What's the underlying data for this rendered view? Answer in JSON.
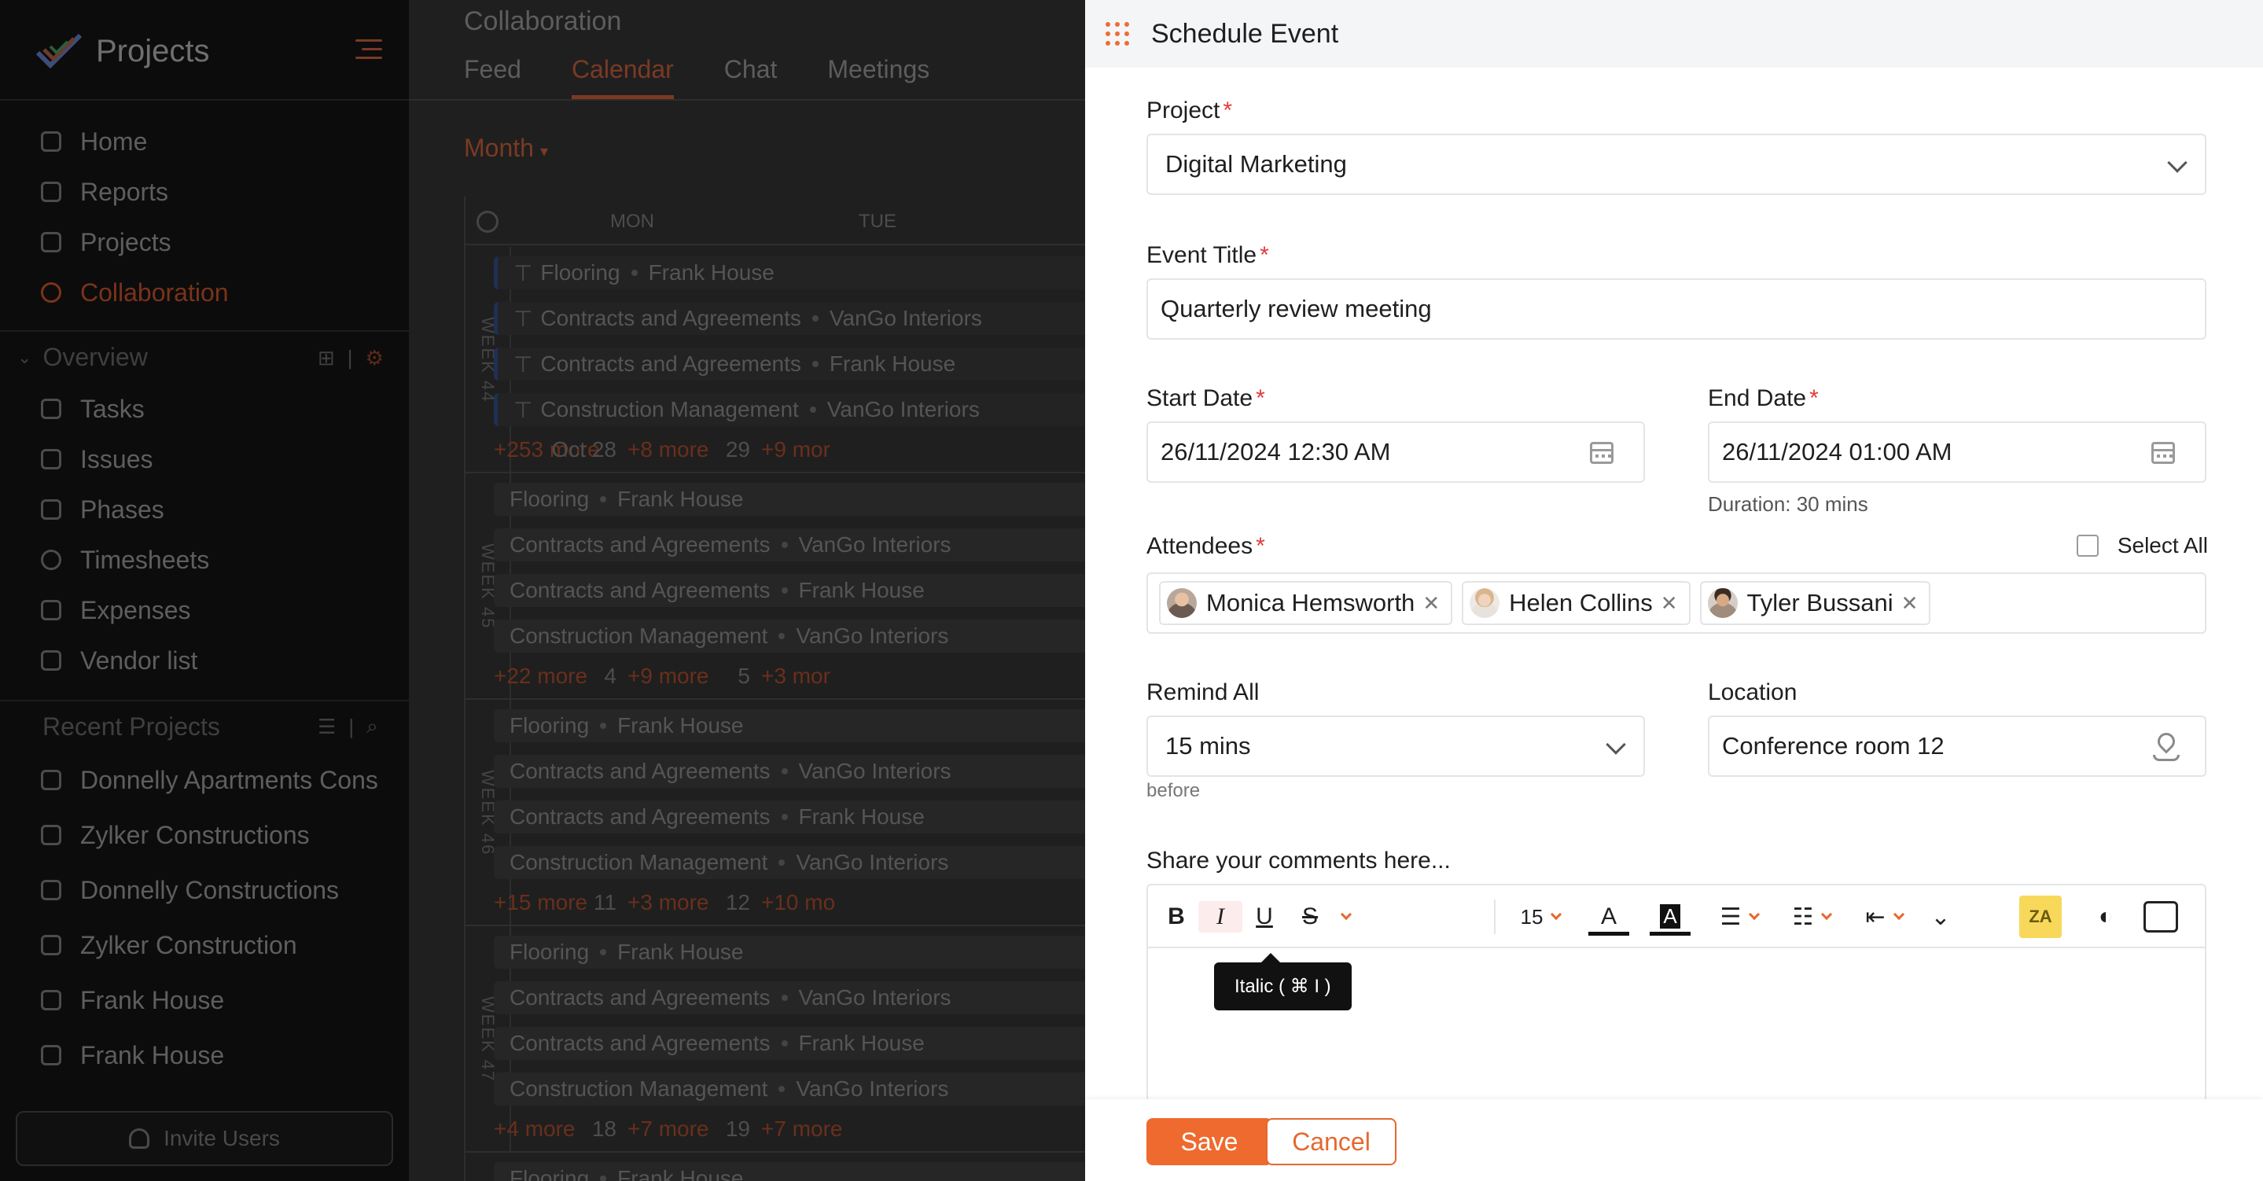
{
  "sidebar": {
    "app_name": "Projects",
    "nav": [
      {
        "label": "Home",
        "icon": "home-icon"
      },
      {
        "label": "Reports",
        "icon": "reports-icon"
      },
      {
        "label": "Projects",
        "icon": "projects-icon"
      },
      {
        "label": "Collaboration",
        "icon": "collaboration-icon",
        "active": true
      }
    ],
    "overview_title": "Overview",
    "overview_items": [
      {
        "label": "Tasks"
      },
      {
        "label": "Issues"
      },
      {
        "label": "Phases"
      },
      {
        "label": "Timesheets"
      },
      {
        "label": "Expenses"
      },
      {
        "label": "Vendor list"
      }
    ],
    "recent_title": "Recent Projects",
    "recent_items": [
      {
        "label": "Donnelly Apartments Cons"
      },
      {
        "label": "Zylker Constructions"
      },
      {
        "label": "Donnelly Constructions"
      },
      {
        "label": "Zylker Construction"
      },
      {
        "label": "Frank House"
      },
      {
        "label": "Frank House"
      }
    ],
    "invite_label": "Invite Users"
  },
  "calendar": {
    "title": "Collaboration",
    "tabs": [
      {
        "label": "Feed"
      },
      {
        "label": "Calendar",
        "active": true
      },
      {
        "label": "Chat"
      },
      {
        "label": "Meetings"
      }
    ],
    "view": "Month",
    "days": [
      "MON",
      "TUE"
    ],
    "weeks": [
      {
        "label": "WEEK 44",
        "events": [
          {
            "task": "Flooring",
            "project": "Frank House"
          },
          {
            "task": "Contracts and Agreements",
            "project": "VanGo Interiors"
          },
          {
            "task": "Contracts and Agreements",
            "project": "Frank House"
          },
          {
            "task": "Construction Management",
            "project": "VanGo Interiors"
          }
        ],
        "more": [
          "+253 more",
          "+8 more",
          "+9 mor"
        ],
        "dates": [
          "Oct 28",
          "29"
        ]
      },
      {
        "label": "WEEK 45",
        "events": [
          {
            "task": "Flooring",
            "project": "Frank House"
          },
          {
            "task": "Contracts and Agreements",
            "project": "VanGo Interiors"
          },
          {
            "task": "Contracts and Agreements",
            "project": "Frank House"
          },
          {
            "task": "Construction Management",
            "project": "VanGo Interiors"
          }
        ],
        "more": [
          "+22 more",
          "+9 more",
          "+3 mor"
        ],
        "dates": [
          "4",
          "5"
        ]
      },
      {
        "label": "WEEK 46",
        "events": [
          {
            "task": "Flooring",
            "project": "Frank House"
          },
          {
            "task": "Contracts and Agreements",
            "project": "VanGo Interiors"
          },
          {
            "task": "Contracts and Agreements",
            "project": "Frank House"
          },
          {
            "task": "Construction Management",
            "project": "VanGo Interiors"
          }
        ],
        "more": [
          "+15 more",
          "+3 more",
          "+10 mo"
        ],
        "dates": [
          "11",
          "12"
        ]
      },
      {
        "label": "WEEK 47",
        "events": [
          {
            "task": "Flooring",
            "project": "Frank House"
          },
          {
            "task": "Contracts and Agreements",
            "project": "VanGo Interiors"
          },
          {
            "task": "Contracts and Agreements",
            "project": "Frank House"
          },
          {
            "task": "Construction Management",
            "project": "VanGo Interiors"
          }
        ],
        "more": [
          "+4 more",
          "+7 more",
          "+7 more"
        ],
        "dates": [
          "18",
          "19"
        ]
      }
    ],
    "last_peek": {
      "task": "Flooring",
      "project": "Frank House"
    }
  },
  "panel": {
    "title": "Schedule Event",
    "project_label": "Project",
    "project_value": "Digital Marketing",
    "event_title_label": "Event Title",
    "event_title_value": "Quarterly review meeting",
    "start_label": "Start Date",
    "start_value": "26/11/2024 12:30 AM",
    "end_label": "End Date",
    "end_value": "26/11/2024 01:00 AM",
    "duration": "Duration: 30 mins",
    "attendees_label": "Attendees",
    "select_all": "Select All",
    "attendees": [
      {
        "name": "Monica Hemsworth"
      },
      {
        "name": "Helen Collins"
      },
      {
        "name": "Tyler Bussani"
      }
    ],
    "remind_label": "Remind All",
    "remind_value": "15 mins",
    "remind_hint": "before",
    "location_label": "Location",
    "location_value": "Conference room 12",
    "comments_label": "Share your comments here...",
    "toolbar": {
      "font_size": "15",
      "tooltip": "Italic ( ⌘ I )",
      "za_label": "ZA"
    },
    "save_label": "Save",
    "cancel_label": "Cancel",
    "required_mark": "*"
  },
  "colors": {
    "accent": "#ee6a2e",
    "required": "#e23b3b",
    "overlay": "#1a1a1a"
  }
}
